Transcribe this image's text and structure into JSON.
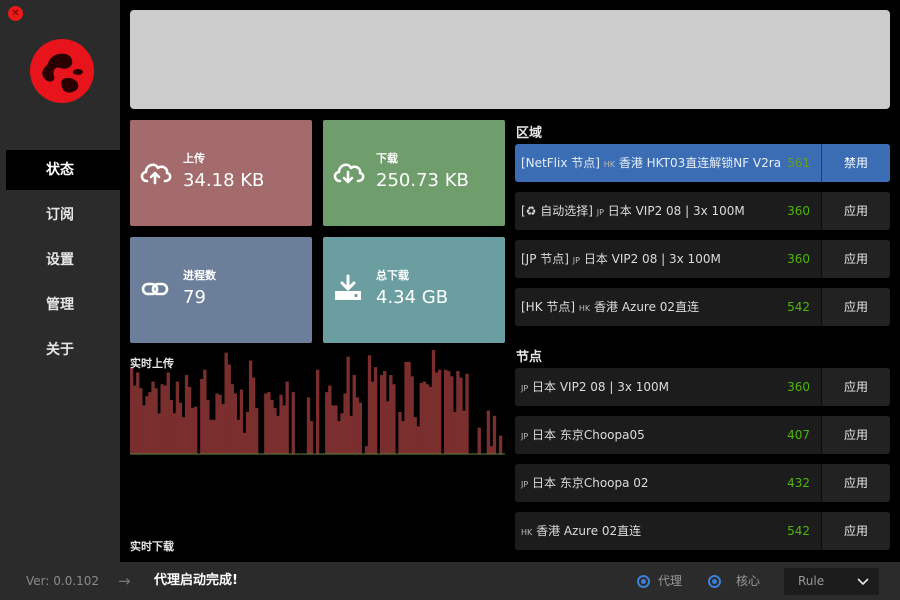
{
  "app": {
    "close_glyph": "✕"
  },
  "sidebar": {
    "items": [
      {
        "label": "状态",
        "active": true
      },
      {
        "label": "订阅"
      },
      {
        "label": "设置"
      },
      {
        "label": "管理"
      },
      {
        "label": "关于"
      }
    ]
  },
  "cards": {
    "upload": {
      "label": "上传",
      "value": "34.18 KB",
      "color": "#a36b6b",
      "icon": "cloud-upload-icon"
    },
    "download": {
      "label": "下载",
      "value": "250.73 KB",
      "color": "#6f9d6c",
      "icon": "cloud-download-icon"
    },
    "processes": {
      "label": "进程数",
      "value": "79",
      "color": "#6c7f9a",
      "icon": "link-icon"
    },
    "total": {
      "label": "总下载",
      "value": "4.34 GB",
      "color": "#6a9ea0",
      "icon": "download-tray-icon"
    }
  },
  "graph": {
    "up_label": "实时上传",
    "down_label": "实时下载",
    "up_color": "#7a2e2e",
    "down_color": "#3d8a34",
    "up_values": [
      66,
      52,
      62,
      50,
      37,
      44,
      47,
      55,
      50,
      31,
      53,
      52,
      62,
      41,
      31,
      55,
      39,
      28,
      60,
      51,
      35,
      36,
      0,
      57,
      64,
      41,
      26,
      26,
      46,
      45,
      38,
      77,
      68,
      53,
      46,
      26,
      49,
      16,
      32,
      71,
      58,
      35,
      0,
      0,
      46,
      47,
      41,
      35,
      29,
      45,
      37,
      55,
      0,
      47,
      0,
      0,
      0,
      0,
      43,
      25,
      0,
      64,
      0,
      0,
      47,
      52,
      37,
      37,
      25,
      31,
      46,
      74,
      29,
      60,
      43,
      39,
      0,
      6,
      75,
      55,
      66,
      0,
      60,
      63,
      40,
      60,
      53,
      0,
      32,
      25,
      70,
      70,
      59,
      28,
      21,
      54,
      55,
      53,
      51,
      79,
      62,
      64,
      0,
      64,
      63,
      59,
      32,
      63,
      58,
      33,
      61,
      0,
      0,
      0,
      20,
      0,
      0,
      33,
      6,
      29,
      0,
      14,
      0
    ],
    "down_values": [
      0,
      0,
      0,
      0,
      0,
      0,
      0,
      0,
      0,
      0,
      0,
      0,
      0,
      0,
      0,
      0,
      0,
      0,
      0,
      0,
      0,
      0,
      0,
      0,
      0,
      0,
      0,
      0,
      0,
      0,
      0,
      0,
      0,
      0,
      0,
      0,
      0,
      0,
      0,
      0,
      0,
      0,
      0,
      0,
      0,
      0,
      0,
      0,
      0,
      0,
      0,
      0,
      0,
      0,
      0,
      0,
      0,
      0,
      0,
      0,
      0,
      0,
      0,
      0,
      0,
      0,
      0,
      0,
      0,
      0,
      0,
      0,
      0,
      0,
      0,
      0,
      0,
      0,
      0,
      0,
      0,
      0,
      0,
      0,
      0,
      0,
      0,
      0,
      0,
      0,
      0,
      0,
      0,
      0,
      0,
      0,
      0,
      0,
      0,
      0,
      0,
      0,
      0,
      0,
      0,
      0,
      0,
      0,
      0,
      0,
      0,
      0,
      0,
      0,
      0,
      0,
      0,
      0,
      0,
      0,
      0,
      0,
      0,
      0,
      0
    ]
  },
  "regions": {
    "title": "区域",
    "items": [
      {
        "prefix": "[NetFlix 节点]",
        "flag": "HK",
        "name": "香港 HKT03直连解锁NF V2ray",
        "latency": "561",
        "action": "禁用",
        "highlight": true
      },
      {
        "prefix": "[♻ 自动选择]",
        "flag": "JP",
        "name": "日本 VIP2 08 | 3x 100M",
        "latency": "360",
        "action": "应用"
      },
      {
        "prefix": "[JP 节点]",
        "flag": "JP",
        "name": "日本 VIP2 08 | 3x 100M",
        "latency": "360",
        "action": "应用"
      },
      {
        "prefix": "[HK 节点]",
        "flag": "HK",
        "name": "香港 Azure 02直连",
        "latency": "542",
        "action": "应用"
      }
    ]
  },
  "nodes": {
    "title": "节点",
    "items": [
      {
        "flag": "JP",
        "name": "日本 VIP2 08 | 3x 100M",
        "latency": "360",
        "action": "应用"
      },
      {
        "flag": "JP",
        "name": "日本 东京Choopa05",
        "latency": "407",
        "action": "应用"
      },
      {
        "flag": "JP",
        "name": "日本 东京Choopa 02",
        "latency": "432",
        "action": "应用"
      },
      {
        "flag": "HK",
        "name": "香港 Azure 02直连",
        "latency": "542",
        "action": "应用"
      }
    ]
  },
  "footer": {
    "version": "Ver: 0.0.102",
    "arrow": "→",
    "status": "代理启动完成!",
    "radio_proxy": "代理",
    "radio_core": "核心",
    "mode": "Rule"
  }
}
